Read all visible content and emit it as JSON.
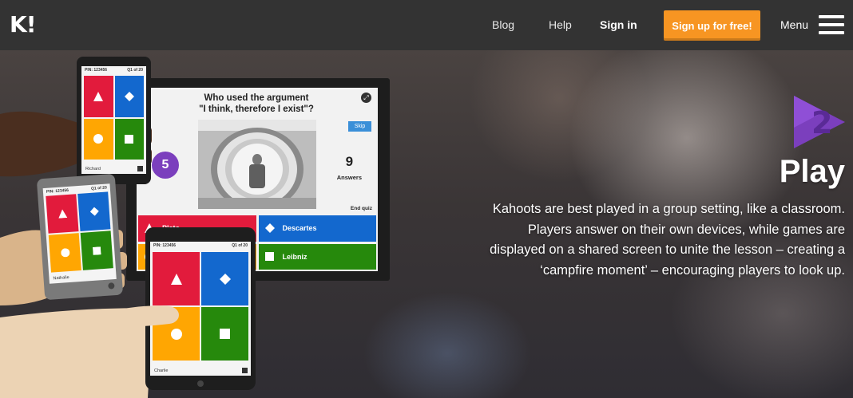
{
  "nav": {
    "logo": "K!",
    "blog": "Blog",
    "help": "Help",
    "sign_in": "Sign in",
    "sign_up": "Sign up for free!",
    "menu": "Menu"
  },
  "hero": {
    "step_number": "2",
    "title": "Play",
    "description": "Kahoots are best played in a group setting, like a classroom. Players answer on their own devices, while games are displayed on a shared screen to unite the lesson – creating a ‘campfire moment’ – encouraging players to look up.",
    "colors": {
      "purple": "#7b3fbd",
      "orange": "#f79522"
    }
  },
  "illustration": {
    "question_line1": "Who used the argument",
    "question_line2": "\"I think, therefore I exist\"?",
    "timer": "5",
    "skip": "Skip",
    "answers_count": "9",
    "answers_label": "Answers",
    "end_quiz": "End quiz",
    "answer_options": [
      "Plato",
      "Descartes",
      "",
      "Leibniz"
    ],
    "colors": {
      "red": "#e21b3c",
      "blue": "#1368ce",
      "yellow": "#ffa602",
      "green": "#26890c"
    },
    "devices": {
      "phone_top_pin": "PIN: 123456",
      "phone_top_q": "Q1 of 20",
      "phone_top_name": "Richard",
      "phone_mid_pin": "PIN: 123456",
      "phone_mid_q": "Q1 of 20",
      "phone_mid_name": "Nathalie",
      "tablet_pin": "PIN: 123456",
      "tablet_q": "Q1 of 20",
      "tablet_name": "Charlie"
    }
  }
}
